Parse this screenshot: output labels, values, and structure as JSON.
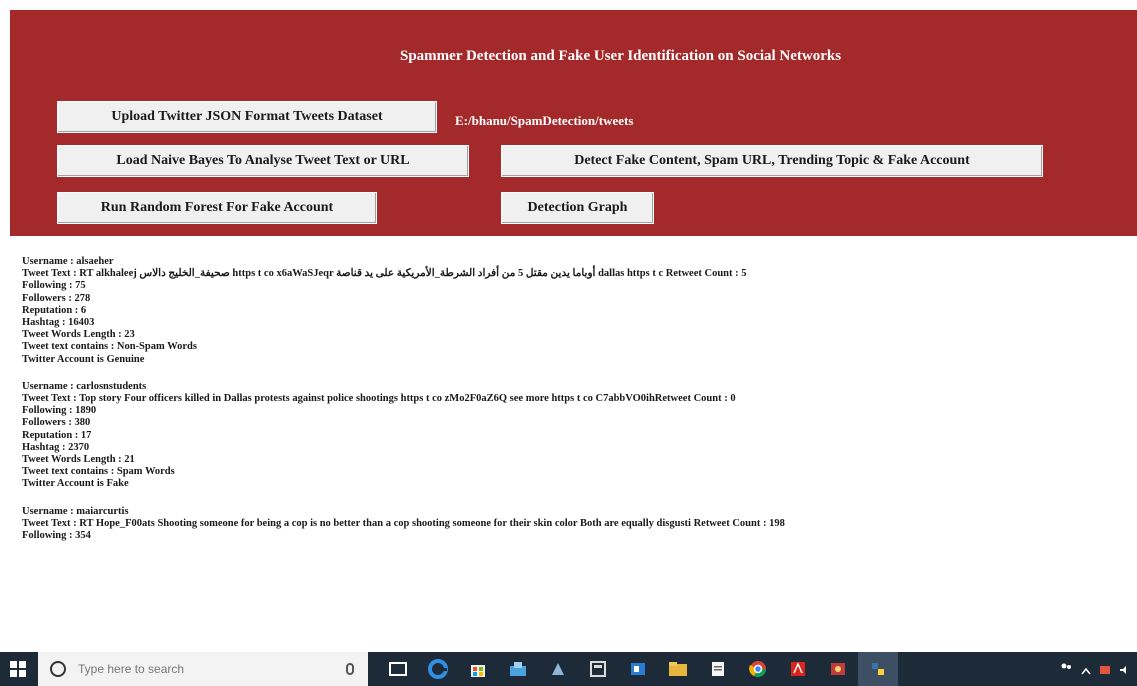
{
  "header": {
    "title": "Spammer Detection and Fake User Identification on Social Networks",
    "dataset_path": "E:/bhanu/SpamDetection/tweets",
    "buttons": {
      "upload": "Upload Twitter JSON Format Tweets Dataset",
      "naive_bayes": "Load Naive Bayes To Analyse Tweet Text or URL",
      "detect": "Detect Fake Content, Spam URL, Trending Topic & Fake Account",
      "random_forest": "Run Random Forest For Fake Account",
      "graph": "Detection Graph"
    }
  },
  "output": {
    "records": [
      {
        "username": "Username : alsaeher",
        "tweet_text": "Tweet Text : RT alkhaleej صحيفة_الخليج دالاس https t co x6aWaSJeqr أوباما يدين مقتل 5 من أفراد الشرطة_الأمريكية على يد قناصة dallas https t c Retweet Count : 5",
        "following": "Following : 75",
        "followers": "Followers : 278",
        "reputation": "Reputation : 6",
        "hashtag": "Hashtag : 16403",
        "words_length": "Tweet Words Length : 23",
        "contains": "Tweet text contains : Non-Spam Words",
        "verdict": "Twitter Account is Genuine"
      },
      {
        "username": "Username : carlosnstudents",
        "tweet_text": "Tweet Text : Top story Four officers killed in Dallas protests against police shootings https t co zMo2F0aZ6Q see more https t co C7abbVO0ihRetweet Count : 0",
        "following": "Following : 1890",
        "followers": "Followers : 380",
        "reputation": "Reputation : 17",
        "hashtag": "Hashtag : 2370",
        "words_length": "Tweet Words Length : 21",
        "contains": "Tweet text contains : Spam Words",
        "verdict": "Twitter Account is Fake"
      },
      {
        "username": "Username : maiarcurtis",
        "tweet_text": "Tweet Text : RT Hope_F00ats Shooting someone for being a cop is no better than a cop shooting someone for their skin color Both are equally disgusti Retweet Count : 198",
        "following": "Following : 354"
      }
    ]
  },
  "taskbar": {
    "search_placeholder": "Type here to search"
  }
}
